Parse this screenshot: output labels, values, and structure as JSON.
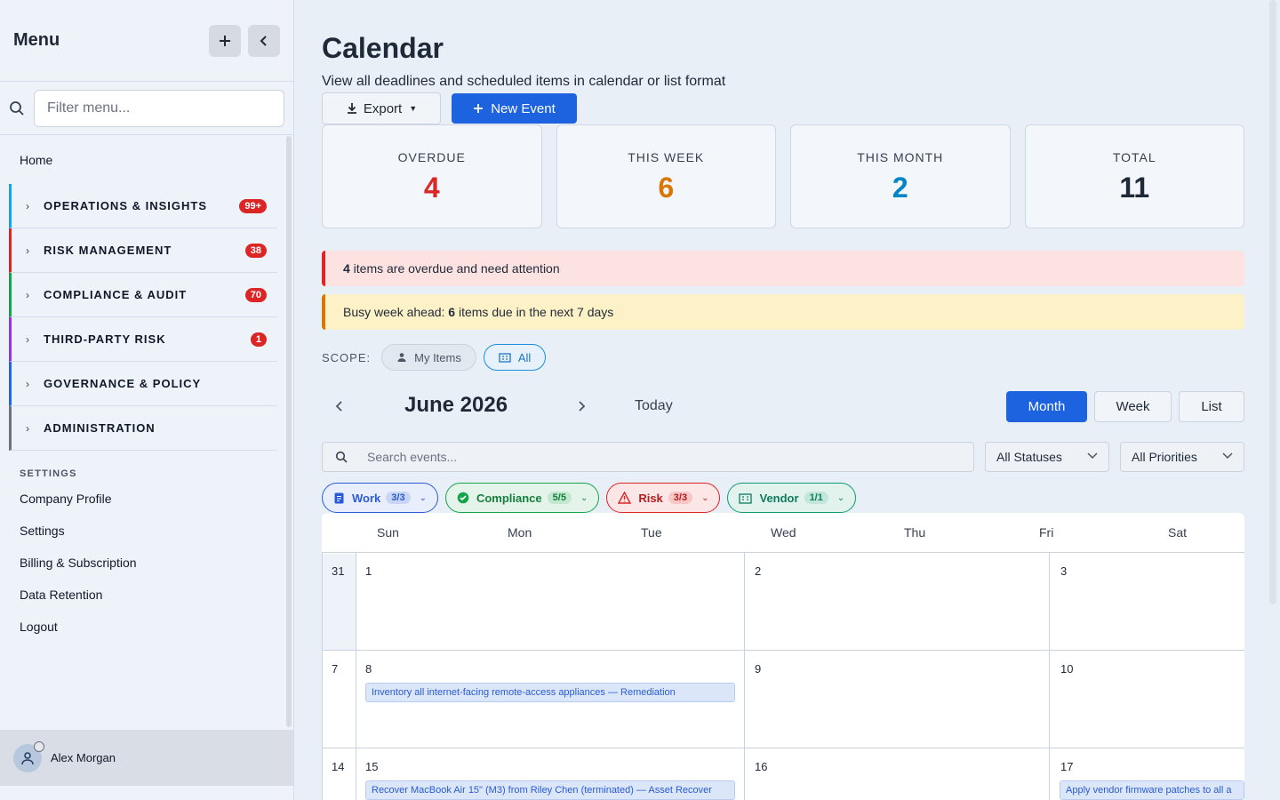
{
  "sidebar": {
    "title": "Menu",
    "filter_placeholder": "Filter menu...",
    "home": "Home",
    "groups": [
      {
        "label": "OPERATIONS & INSIGHTS",
        "badge": "99+",
        "color": "#0ea5e9"
      },
      {
        "label": "RISK MANAGEMENT",
        "badge": "38",
        "color": "#dc2626"
      },
      {
        "label": "COMPLIANCE & AUDIT",
        "badge": "70",
        "color": "#16a34a"
      },
      {
        "label": "THIRD-PARTY RISK",
        "badge": "1",
        "color": "#9333ea"
      },
      {
        "label": "GOVERNANCE & POLICY",
        "badge": "",
        "color": "#2563eb"
      },
      {
        "label": "ADMINISTRATION",
        "badge": "",
        "color": "#6b7280"
      }
    ],
    "settings_heading": "SETTINGS",
    "links": [
      "Company Profile",
      "Settings",
      "Billing & Subscription",
      "Data Retention",
      "Logout"
    ],
    "user_name": "Alex Morgan"
  },
  "header": {
    "title": "Calendar",
    "subtitle": "View all deadlines and scheduled items in calendar or list format",
    "export_label": "Export",
    "new_event_label": "New Event"
  },
  "stats": [
    {
      "label": "OVERDUE",
      "value": "4",
      "color": "#dc2626"
    },
    {
      "label": "THIS WEEK",
      "value": "6",
      "color": "#d97706"
    },
    {
      "label": "THIS MONTH",
      "value": "2",
      "color": "#0284c7"
    },
    {
      "label": "TOTAL",
      "value": "11",
      "color": "#1f2937"
    }
  ],
  "alerts": {
    "overdue_count": "4",
    "overdue_text": " items are overdue and need attention",
    "busy_prefix": "Busy week ahead: ",
    "busy_count": "6",
    "busy_suffix": " items due in the next 7 days"
  },
  "scope": {
    "label": "SCOPE:",
    "my_items": "My Items",
    "all": "All"
  },
  "calendar_nav": {
    "month_title": "June 2026",
    "today": "Today",
    "views": [
      "Month",
      "Week",
      "List"
    ],
    "active_view": "Month"
  },
  "filters": {
    "search_placeholder": "Search events...",
    "status": "All Statuses",
    "priority": "All Priorities",
    "categories": [
      {
        "label": "Work",
        "count": "3/3"
      },
      {
        "label": "Compliance",
        "count": "5/5"
      },
      {
        "label": "Risk",
        "count": "3/3"
      },
      {
        "label": "Vendor",
        "count": "1/1"
      }
    ]
  },
  "calendar": {
    "days": [
      "Sun",
      "Mon",
      "Tue",
      "Wed",
      "Thu",
      "Fri",
      "Sat"
    ],
    "week_numbers": [
      "31",
      "7",
      "14"
    ],
    "row1": [
      "1",
      "2",
      "3"
    ],
    "row2": [
      "8",
      "9",
      "10"
    ],
    "row3": [
      "15",
      "16",
      "17"
    ],
    "events": [
      "Inventory all internet-facing remote-access appliances — Remediation",
      "Recover MacBook Air 15\" (M3) from Riley Chen (terminated) — Asset Recover",
      "Apply vendor firmware patches to all a"
    ]
  }
}
